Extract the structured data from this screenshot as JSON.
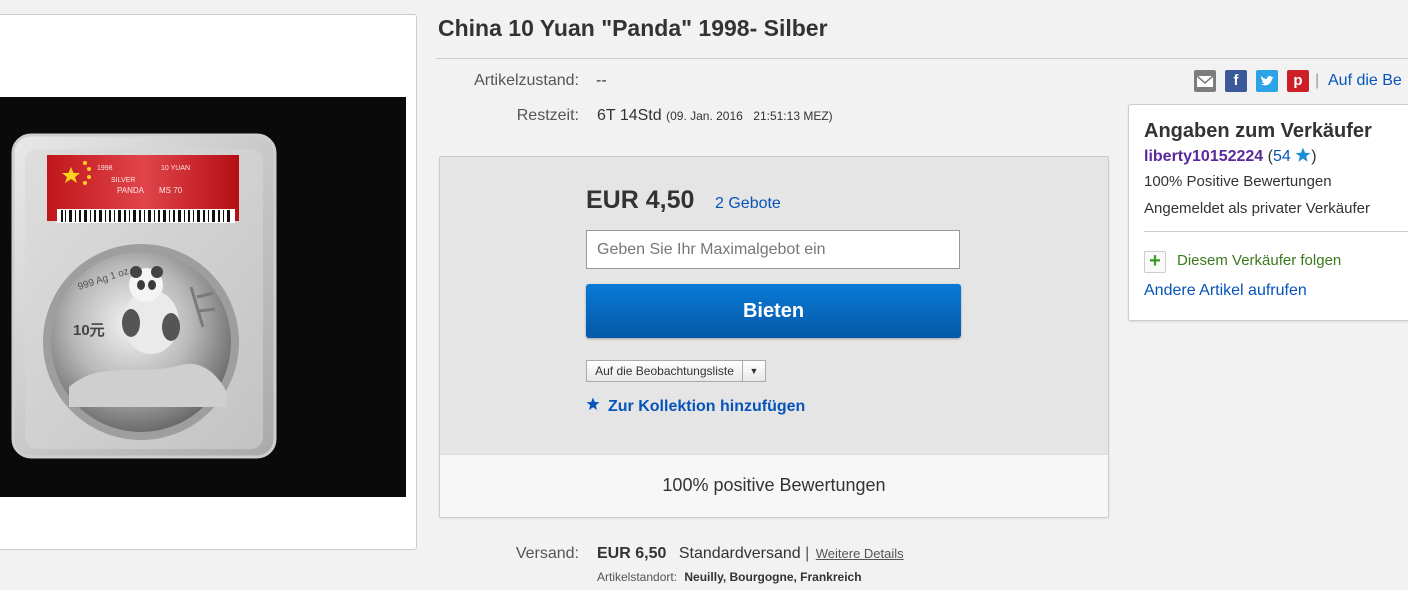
{
  "title": "China 10 Yuan \"Panda\" 1998- Silber",
  "details": {
    "condition_label": "Artikelzustand:",
    "condition_value": "--",
    "remaining_label": "Restzeit:",
    "remaining_value": "6T 14Std",
    "end_date": "(09. Jan. 2016",
    "end_time": "21:51:13 MEZ)"
  },
  "share": {
    "icons": [
      "email-icon",
      "facebook-icon",
      "twitter-icon",
      "pinterest-icon"
    ],
    "separator": "|",
    "watch_link": "Auf die Be"
  },
  "bid": {
    "price": "EUR 4,50",
    "bids_link": "2 Gebote",
    "input_placeholder": "Geben Sie Ihr Maximalgebot ein",
    "button_label": "Bieten",
    "watchlist_label": "Auf die Beobachtungsliste",
    "collection_label": "Zur Kollektion hinzufügen",
    "feedback_text": "100% positive Bewertungen"
  },
  "seller": {
    "heading": "Angaben zum Verkäufer",
    "username": "liberty10152224",
    "score_open": "(",
    "score": "54",
    "score_close": ")",
    "positive": "100% Positive Bewertungen",
    "account_type": "Angemeldet als privater Verkäufer",
    "follow_label": "Diesem Verkäufer folgen",
    "other_items_label": "Andere Artikel aufrufen"
  },
  "shipping": {
    "label": "Versand:",
    "price": "EUR 6,50",
    "method": "Standardversand",
    "separator": "|",
    "details_link": "Weitere Details",
    "location_label": "Artikelstandort:",
    "location_value": "Neuilly, Bourgogne, Frankreich"
  },
  "coin_slab": {
    "label_lines": [
      "1998",
      "10 YUAN",
      "PANDA",
      "MS 70",
      "SILVER"
    ],
    "coin_text": [
      "999 Ag 1 oz",
      "10元"
    ]
  },
  "colors": {
    "link_blue": "#0654ba",
    "button_blue": "#0a6cc7",
    "seller_purple": "#5a2a9b",
    "follow_green": "#3a7a1c",
    "star_blue": "#1a8fd6"
  }
}
